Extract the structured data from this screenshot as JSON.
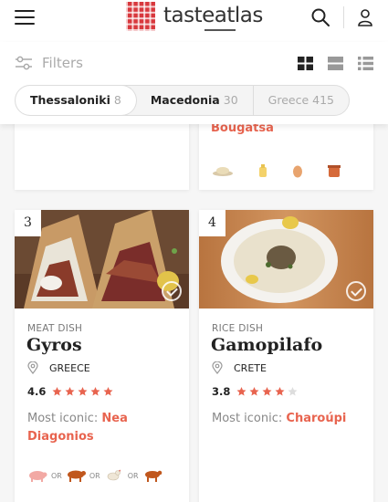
{
  "header": {
    "logo_text": "tasteatlas",
    "icons": {
      "menu": "hamburger-menu-icon",
      "search": "search-icon",
      "user": "user-icon"
    }
  },
  "filterbar": {
    "filters_label": "Filters",
    "view_icons": [
      "grid-view-icon",
      "list-large-view-icon",
      "list-compact-view-icon"
    ],
    "chips": [
      {
        "label": "Thessaloniki",
        "count": "8",
        "active": true
      },
      {
        "label": "Macedonia",
        "count": "30",
        "active": true
      },
      {
        "label": "Greece",
        "count": "415",
        "active": false
      }
    ]
  },
  "top_cards": {
    "right": {
      "iconic_name": "Bougatsa",
      "ingredients": [
        "semolina-icon",
        "butter-icon",
        "egg-icon",
        "honey-jar-icon"
      ]
    }
  },
  "cards": [
    {
      "rank": "3",
      "type": "MEAT DISH",
      "name": "Gyros",
      "location": "GREECE",
      "rating": "4.6",
      "rating_value": 4.6,
      "iconic_label": "Most iconic:",
      "iconic_name": "Nea Diagonios",
      "ingredients": [
        "pork-icon",
        "beef-icon",
        "chicken-icon",
        "veal-icon"
      ],
      "or_label": "OR"
    },
    {
      "rank": "4",
      "type": "RICE DISH",
      "name": "Gamopilafo",
      "location": "CRETE",
      "rating": "3.8",
      "rating_value": 3.8,
      "iconic_label": "Most iconic:",
      "iconic_name": "Charoúpi"
    }
  ],
  "colors": {
    "accent": "#e8644f",
    "star": "#e8644f",
    "logo": "#d8383d"
  }
}
